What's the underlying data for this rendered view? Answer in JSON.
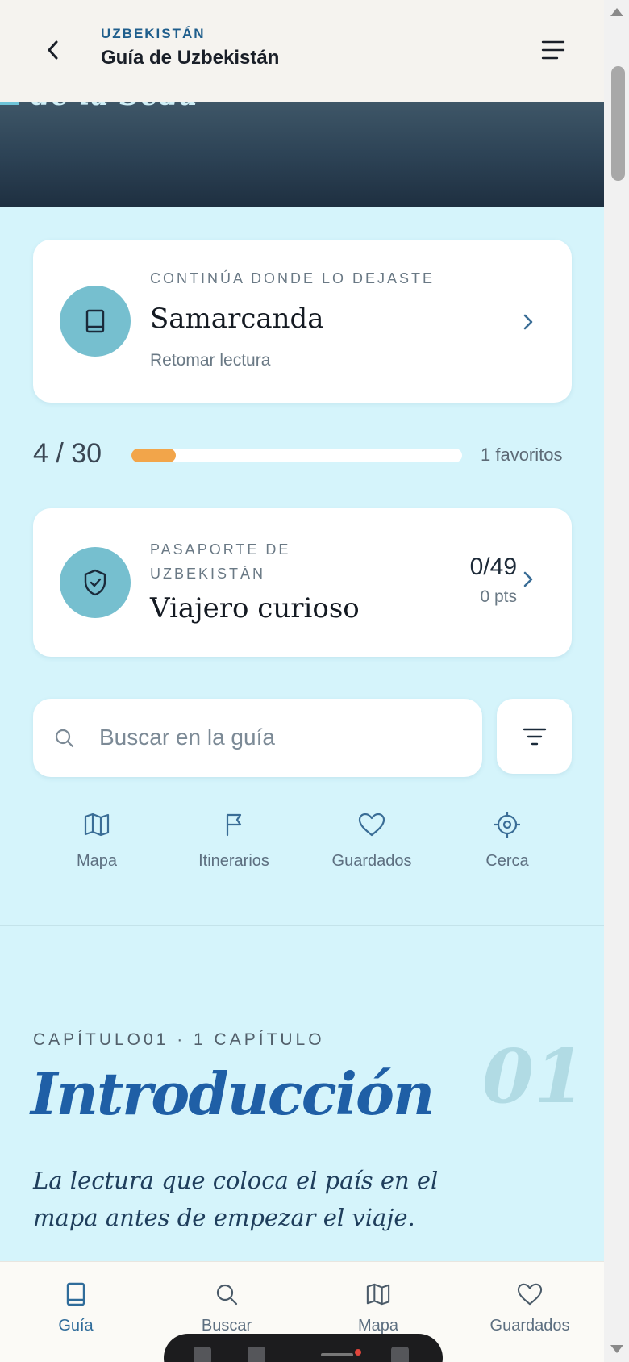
{
  "header": {
    "kicker": "UZBEKISTÁN",
    "title": "Guía de Uzbekistán"
  },
  "hero": {
    "visible_text": "de la Seda"
  },
  "continue_card": {
    "kicker": "CONTINÚA DONDE LO DEJASTE",
    "title": "Samarcanda",
    "subtitle": "Retomar lectura"
  },
  "progress": {
    "count": "4 / 30",
    "fraction": 0.1333,
    "favorites": "1 favoritos"
  },
  "passport_card": {
    "kicker": "PASAPORTE DE UZBEKISTÁN",
    "title": "Viajero curioso",
    "score": "0/49",
    "points": "0 pts"
  },
  "search": {
    "placeholder": "Buscar en la guía",
    "value": ""
  },
  "quick_nav": [
    {
      "label": "Mapa",
      "icon": "map-icon"
    },
    {
      "label": "Itinerarios",
      "icon": "flag-icon"
    },
    {
      "label": "Guardados",
      "icon": "heart-icon"
    },
    {
      "label": "Cerca",
      "icon": "location-target-icon"
    }
  ],
  "chapter": {
    "kicker": "CAPÍTULO01 · 1 CAPÍTULO",
    "number": "01",
    "title": "Introducción",
    "description": "La lectura que coloca el país en el mapa antes de empezar el viaje."
  },
  "bottom_nav": [
    {
      "label": "Guía",
      "icon": "book-icon",
      "active": true
    },
    {
      "label": "Buscar",
      "icon": "search-icon",
      "active": false
    },
    {
      "label": "Mapa",
      "icon": "map-icon",
      "active": false
    },
    {
      "label": "Guardados",
      "icon": "heart-icon",
      "active": false
    }
  ],
  "colors": {
    "background": "#d5f4fb",
    "accent_blue": "#1f5fa6",
    "icon_circle": "#76bfcf",
    "progress_fill": "#f2a54a"
  }
}
